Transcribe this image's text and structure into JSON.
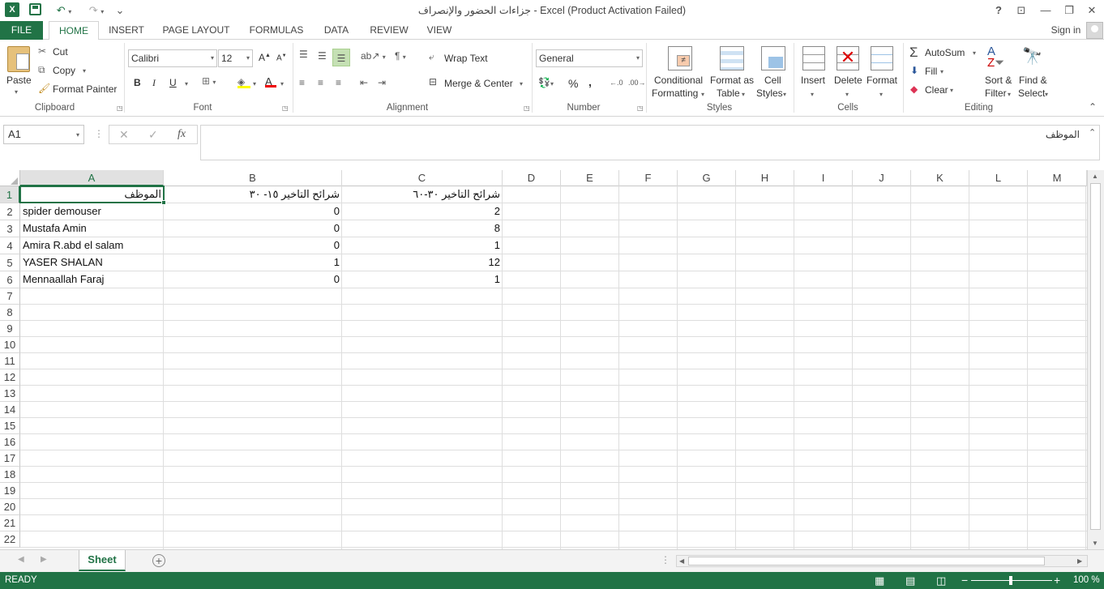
{
  "window": {
    "title": "جزاءات الحضور والإنصراف - Excel (Product Activation Failed)",
    "help": "?",
    "sign_in": "Sign in"
  },
  "tabs": [
    "FILE",
    "HOME",
    "INSERT",
    "PAGE LAYOUT",
    "FORMULAS",
    "DATA",
    "REVIEW",
    "VIEW"
  ],
  "ribbon": {
    "clipboard": {
      "paste": "Paste",
      "cut": "Cut",
      "copy": "Copy",
      "format_painter": "Format Painter",
      "label": "Clipboard"
    },
    "font": {
      "name": "Calibri",
      "size": "12",
      "bold": "B",
      "italic": "I",
      "underline": "U",
      "label": "Font"
    },
    "alignment": {
      "wrap_text": "Wrap Text",
      "merge_center": "Merge & Center",
      "label": "Alignment"
    },
    "number": {
      "format": "General",
      "percent": "%",
      "comma": ",",
      "label": "Number"
    },
    "styles": {
      "conditional_1": "Conditional",
      "conditional_2": "Formatting",
      "format_table_1": "Format as",
      "format_table_2": "Table",
      "cell_styles_1": "Cell",
      "cell_styles_2": "Styles",
      "label": "Styles"
    },
    "cells": {
      "insert": "Insert",
      "delete": "Delete",
      "format": "Format",
      "label": "Cells"
    },
    "editing": {
      "autosum": "AutoSum",
      "fill": "Fill",
      "clear": "Clear",
      "sort_1": "Sort &",
      "sort_2": "Filter",
      "find_1": "Find &",
      "find_2": "Select",
      "label": "Editing"
    }
  },
  "formula_bar": {
    "name_box": "A1",
    "fx": "fx",
    "cancel": "✕",
    "enter": "✓",
    "content": "الموظف"
  },
  "columns": [
    "A",
    "B",
    "C",
    "D",
    "E",
    "F",
    "G",
    "H",
    "I",
    "J",
    "K",
    "L",
    "M"
  ],
  "rows": [
    "1",
    "2",
    "3",
    "4",
    "5",
    "6",
    "7",
    "8",
    "9",
    "10",
    "11",
    "12",
    "13",
    "14",
    "15",
    "16",
    "17",
    "18",
    "19",
    "20",
    "21",
    "22"
  ],
  "cells": {
    "headers": [
      "الموظف",
      "شرائح التاخير ١٥- ٣٠",
      "شرائح التاخير ٣٠-٦٠"
    ],
    "data": [
      {
        "name": "spider demouser",
        "b": "0",
        "c": "2"
      },
      {
        "name": "Mustafa Amin",
        "b": "0",
        "c": "8"
      },
      {
        "name": "Amira R.abd el salam",
        "b": "0",
        "c": "1"
      },
      {
        "name": "YASER SHALAN",
        "b": "1",
        "c": "12"
      },
      {
        "name": "Mennaallah Faraj",
        "b": "0",
        "c": "1"
      }
    ]
  },
  "sheet": {
    "name": "Sheet"
  },
  "status": {
    "ready": "READY",
    "zoom": "100 %"
  },
  "colors": {
    "accent": "#217346"
  }
}
